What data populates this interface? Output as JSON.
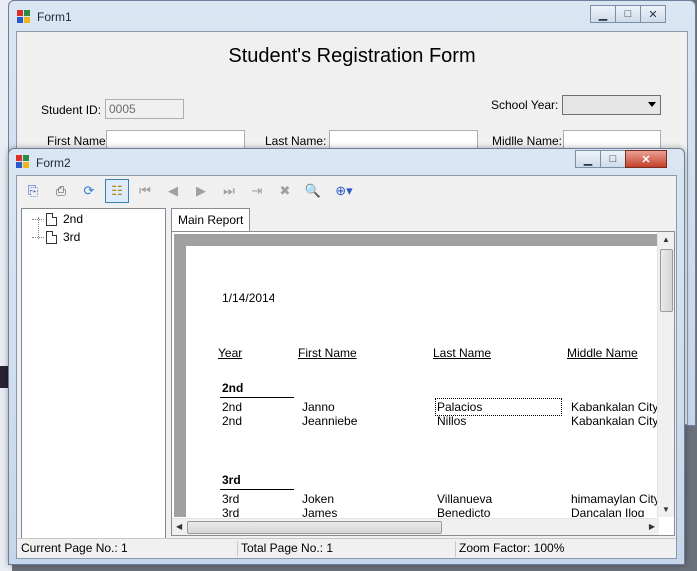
{
  "form1": {
    "title": "Form1",
    "controls": {
      "minimize": "▁",
      "maximize": "□",
      "close": "✕"
    },
    "heading": "Student's Registration Form",
    "student_id": {
      "label": "Student ID:",
      "value": "0005"
    },
    "school_year": {
      "label": "School Year:",
      "value": ""
    },
    "first_name": {
      "label": "First Name:",
      "value": ""
    },
    "last_name": {
      "label": "Last Name:",
      "value": ""
    },
    "middle_name": {
      "label": "Midlle Name:",
      "value": ""
    }
  },
  "form2": {
    "title": "Form2",
    "controls": {
      "minimize": "▁",
      "maximize": "□",
      "close": "✕"
    },
    "toolbar": {
      "buttons": [
        {
          "icon": "export-icon",
          "glyph": "⎘"
        },
        {
          "icon": "print-icon",
          "glyph": "⎙"
        },
        {
          "icon": "refresh-icon",
          "glyph": "⟳"
        },
        {
          "icon": "group-tree-icon",
          "glyph": "☷"
        },
        {
          "icon": "first-page-icon",
          "glyph": "⏮"
        },
        {
          "icon": "previous-page-icon",
          "glyph": "◀"
        },
        {
          "icon": "next-page-icon",
          "glyph": "▶"
        },
        {
          "icon": "last-page-icon",
          "glyph": "⏭"
        },
        {
          "icon": "goto-page-icon",
          "glyph": "⇥"
        },
        {
          "icon": "stop-icon",
          "glyph": "✖"
        },
        {
          "icon": "find-icon",
          "glyph": "🔍"
        },
        {
          "icon": "zoom-icon",
          "glyph": "⊕▾"
        }
      ]
    },
    "tree": {
      "items": [
        "2nd",
        "3rd"
      ]
    },
    "tab": "Main Report",
    "report": {
      "date": "1/14/2014",
      "headers": [
        "Year",
        "First Name",
        "Last Name",
        "Middle Name"
      ],
      "groups": [
        {
          "name": "2nd",
          "rows": [
            [
              "2nd",
              "Janno",
              "Palacios",
              "Kabankalan City"
            ],
            [
              "2nd",
              "Jeanniebe",
              "Nillos",
              "Kabankalan City"
            ]
          ]
        },
        {
          "name": "3rd",
          "rows": [
            [
              "3rd",
              "Joken",
              "Villanueva",
              "himamaylan City"
            ],
            [
              "3rd",
              "James",
              "Benedicto",
              "Dancalan Ilog"
            ]
          ]
        }
      ]
    },
    "status": {
      "current_page": "Current Page No.: 1",
      "total_page": "Total Page No.: 1",
      "zoom": "Zoom Factor: 100%"
    }
  }
}
